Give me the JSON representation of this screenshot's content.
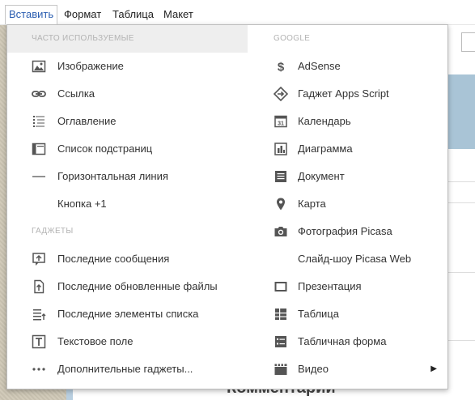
{
  "menubar": {
    "items": [
      "Вставить",
      "Формат",
      "Таблица",
      "Макет"
    ]
  },
  "menu": {
    "left_sections": [
      {
        "header": "ЧАСТО ИСПОЛЬЗУЕМЫЕ",
        "items": [
          {
            "label": "Изображение",
            "icon": "image-icon"
          },
          {
            "label": "Ссылка",
            "icon": "link-icon"
          },
          {
            "label": "Оглавление",
            "icon": "table-of-contents-icon"
          },
          {
            "label": "Список подстраниц",
            "icon": "subpage-list-icon"
          },
          {
            "label": "Горизонтальная линия",
            "icon": "horizontal-line-icon"
          },
          {
            "label": "Кнопка +1",
            "icon": ""
          }
        ]
      },
      {
        "header": "ГАДЖЕТЫ",
        "items": [
          {
            "label": "Последние сообщения",
            "icon": "recent-posts-icon"
          },
          {
            "label": "Последние обновленные файлы",
            "icon": "recent-files-icon"
          },
          {
            "label": "Последние элементы списка",
            "icon": "recent-list-items-icon"
          },
          {
            "label": "Текстовое поле",
            "icon": "text-box-icon"
          },
          {
            "label": "Дополнительные гаджеты...",
            "icon": "more-gadgets-icon"
          }
        ]
      }
    ],
    "right_section": {
      "header": "GOOGLE",
      "items": [
        {
          "label": "AdSense",
          "icon": "adsense-dollar-icon"
        },
        {
          "label": "Гаджет Apps Script",
          "icon": "apps-script-icon"
        },
        {
          "label": "Календарь",
          "icon": "calendar-icon"
        },
        {
          "label": "Диаграмма",
          "icon": "chart-icon"
        },
        {
          "label": "Документ",
          "icon": "document-icon"
        },
        {
          "label": "Карта",
          "icon": "map-pin-icon"
        },
        {
          "label": "Фотография Picasa",
          "icon": "camera-icon"
        },
        {
          "label": "Слайд-шоу Picasa Web",
          "icon": ""
        },
        {
          "label": "Презентация",
          "icon": "presentation-icon"
        },
        {
          "label": "Таблица",
          "icon": "spreadsheet-icon"
        },
        {
          "label": "Табличная форма",
          "icon": "form-icon"
        },
        {
          "label": "Видео",
          "icon": "video-icon",
          "submenu": true
        }
      ]
    },
    "submenu_arrow": "▶"
  },
  "background": {
    "comment_heading": "Комментарии"
  }
}
